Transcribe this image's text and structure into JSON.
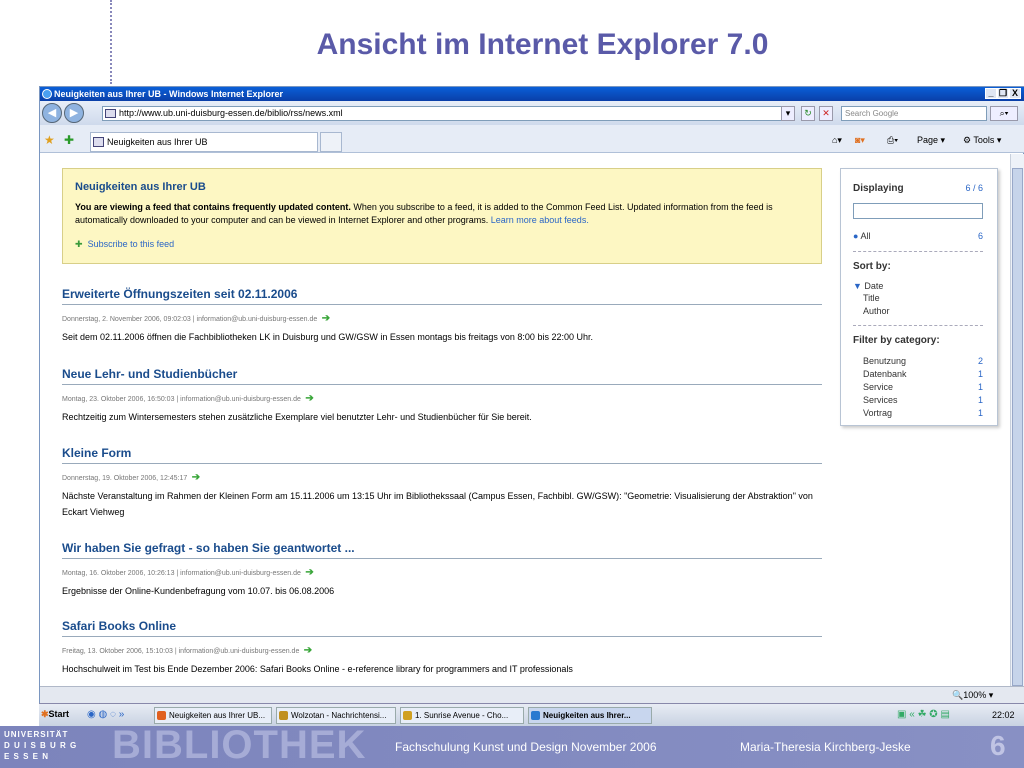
{
  "slide": {
    "title": "Ansicht im Internet Explorer 7.0",
    "footer_course": "Fachschulung Kunst und Design November  2006",
    "footer_author": "Maria-Theresia Kirchberg-Jeske",
    "page_number": "6",
    "logo_word": "BIBLIOTHEK",
    "logo_lines": [
      "UNIVERSITÄT",
      "D U I S B U R G",
      "E S S E N"
    ]
  },
  "window": {
    "title": "Neuigkeiten aus Ihrer UB - Windows Internet Explorer",
    "controls": [
      "_",
      "❐",
      "X"
    ]
  },
  "address": {
    "url": "http://www.ub.uni-duisburg-essen.de/biblio/rss/news.xml",
    "search_placeholder": "Search Google"
  },
  "tab": {
    "label": "Neuigkeiten aus Ihrer UB"
  },
  "toolbar": {
    "page_label": "Page",
    "tools_label": "Tools"
  },
  "notice": {
    "title": "Neuigkeiten aus Ihrer UB",
    "bold": "You are viewing a feed that contains frequently updated content.",
    "text": " When you subscribe to a feed, it is added to the Common Feed List. Updated information from the feed is automatically downloaded to your computer and can be viewed in Internet Explorer and other programs. ",
    "link": "Learn more about feeds.",
    "subscribe": "Subscribe to this feed"
  },
  "posts": [
    {
      "title": "Erweiterte Öffnungszeiten seit 02.11.2006",
      "meta": "Donnerstag, 2. November 2006, 09:02:03 | information@ub.uni-duisburg-essen.de",
      "body": "Seit dem 02.11.2006 öffnen die Fachbibliotheken LK in Duisburg und GW/GSW in Essen montags bis freitags von 8:00 bis 22:00 Uhr."
    },
    {
      "title": "Neue Lehr- und Studienbücher",
      "meta": "Montag, 23. Oktober 2006, 16:50:03 | information@ub.uni-duisburg-essen.de",
      "body": "Rechtzeitig zum Wintersemesters stehen zusätzliche Exemplare viel benutzter Lehr- und Studienbücher für Sie bereit."
    },
    {
      "title": "Kleine Form",
      "meta": "Donnerstag, 19. Oktober 2006, 12:45:17",
      "body": "Nächste Veranstaltung im Rahmen der Kleinen Form am 15.11.2006 um 13:15 Uhr im Bibliothekssaal (Campus Essen, Fachbibl. GW/GSW): \"Geometrie: Visualisierung der Abstraktion\" von Eckart Viehweg"
    },
    {
      "title": "Wir haben Sie gefragt - so haben Sie geantwortet ...",
      "meta": "Montag, 16. Oktober 2006, 10:26:13 | information@ub.uni-duisburg-essen.de",
      "body": "Ergebnisse der Online-Kundenbefragung vom 10.07. bis 06.08.2006"
    },
    {
      "title": "Safari Books Online",
      "meta": "Freitag, 13. Oktober 2006, 15:10:03 | information@ub.uni-duisburg-essen.de",
      "body": "Hochschulweit im Test bis Ende Dezember 2006: Safari Books Online - e-reference library for programmers and IT professionals"
    }
  ],
  "side": {
    "displaying": "Displaying",
    "count": "6 / 6",
    "all": "All",
    "all_count": "6",
    "sort_by": "Sort by:",
    "sort": [
      "Date",
      "Title",
      "Author"
    ],
    "filter": "Filter by category:",
    "categories": [
      {
        "name": "Benutzung",
        "n": "2"
      },
      {
        "name": "Datenbank",
        "n": "1"
      },
      {
        "name": "Service",
        "n": "1"
      },
      {
        "name": "Services",
        "n": "1"
      },
      {
        "name": "Vortrag",
        "n": "1"
      }
    ]
  },
  "status": {
    "zoom": "100%"
  },
  "taskbar": {
    "start": "Start",
    "items": [
      "Neuigkeiten aus Ihrer UB...",
      "Wolzotan - Nachrichtensi...",
      "1. Sunrise Avenue - Cho...",
      "Neuigkeiten aus Ihrer..."
    ],
    "clock": "22:02"
  }
}
